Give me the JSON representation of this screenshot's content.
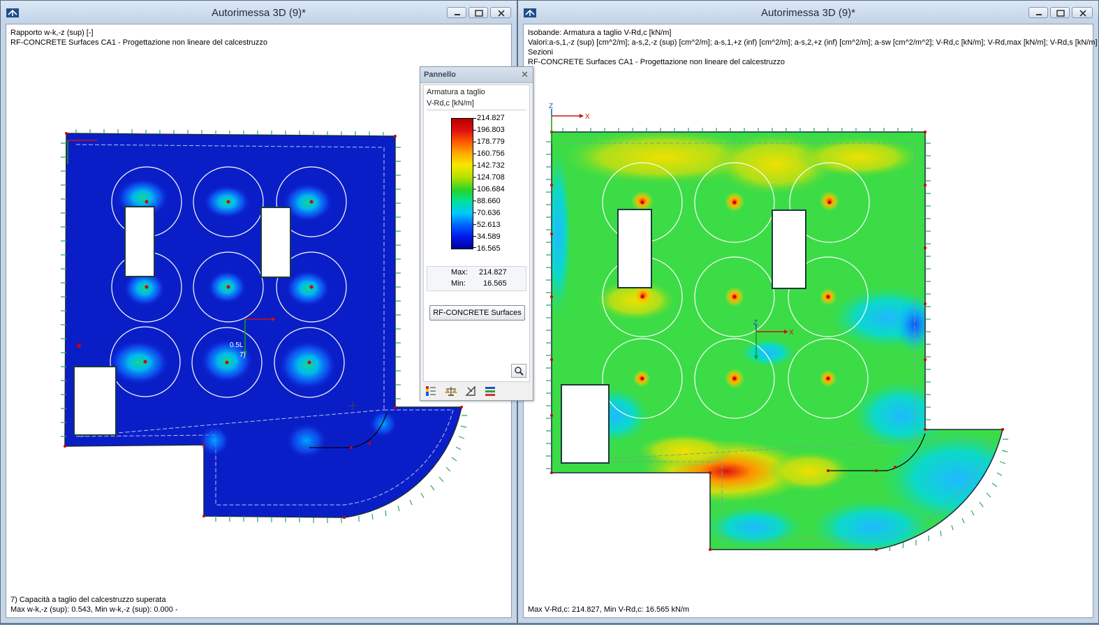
{
  "left_window": {
    "title": "Autorimessa 3D (9)*",
    "info": [
      "Rapporto w-k,-z (sup) [-]",
      "RF-CONCRETE Surfaces CA1 - Progettazione non lineare del calcestruzzo"
    ],
    "footer": [
      "7) Capacità a taglio del calcestruzzo superata",
      "Max w-k,-z (sup): 0.543, Min w-k,-z (sup): 0.000 -"
    ],
    "model_label": "0.5L",
    "axis_label": "7)"
  },
  "right_window": {
    "title": "Autorimessa 3D (9)*",
    "info": [
      "Isobande: Armatura a taglio V-Rd,c [kN/m]",
      "Valori:a-s,1,-z (sup) [cm^2/m]; a-s,2,-z (sup) [cm^2/m]; a-s,1,+z (inf) [cm^2/m]; a-s,2,+z (inf) [cm^2/m]; a-sw [cm^2/m^2]; V-Rd,c [kN/m]; V-Rd,max [kN/m]; V-Rd,s [kN/m]",
      "Sezioni",
      "RF-CONCRETE Surfaces CA1 - Progettazione non lineare del calcestruzzo"
    ],
    "footer": "Max V-Rd,c: 214.827, Min V-Rd,c: 16.565 kN/m"
  },
  "axes": {
    "x": "X",
    "z": "Z"
  },
  "panel": {
    "title": "Pannello",
    "heading1": "Armatura a taglio",
    "heading2": "V-Rd,c [kN/m]",
    "legend_values": [
      "214.827",
      "196.803",
      "178.779",
      "160.756",
      "142.732",
      "124.708",
      "106.684",
      "88.660",
      "70.636",
      "52.613",
      "34.589",
      "16.565"
    ],
    "max_label": "Max:",
    "max_value": "214.827",
    "min_label": "Min:",
    "min_value": "16.565",
    "button": "RF-CONCRETE Surfaces"
  },
  "colors": {
    "title_text": "#1e2a3a",
    "deep_blue": "#0a1ec8",
    "field_green": "#3cdc46",
    "node_red": "#cc0000"
  }
}
